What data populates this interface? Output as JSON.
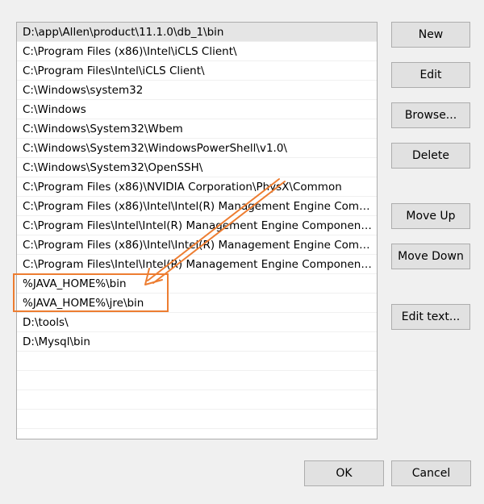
{
  "path_list": {
    "items": [
      "D:\\app\\Allen\\product\\11.1.0\\db_1\\bin",
      "C:\\Program Files (x86)\\Intel\\iCLS Client\\",
      "C:\\Program Files\\Intel\\iCLS Client\\",
      "C:\\Windows\\system32",
      "C:\\Windows",
      "C:\\Windows\\System32\\Wbem",
      "C:\\Windows\\System32\\WindowsPowerShell\\v1.0\\",
      "C:\\Windows\\System32\\OpenSSH\\",
      "C:\\Program Files (x86)\\NVIDIA Corporation\\PhysX\\Common",
      "C:\\Program Files (x86)\\Intel\\Intel(R) Management Engine Comp...",
      "C:\\Program Files\\Intel\\Intel(R) Management Engine Components...",
      "C:\\Program Files (x86)\\Intel\\Intel(R) Management Engine Comp...",
      "C:\\Program Files\\Intel\\Intel(R) Management Engine Components...",
      "%JAVA_HOME%\\bin",
      "%JAVA_HOME%\\jre\\bin",
      "D:\\tools\\",
      "D:\\Mysql\\bin"
    ],
    "selected_index": 0
  },
  "buttons": {
    "new": "New",
    "edit": "Edit",
    "browse": "Browse...",
    "delete": "Delete",
    "move_up": "Move Up",
    "move_down": "Move Down",
    "edit_text": "Edit text...",
    "ok": "OK",
    "cancel": "Cancel"
  },
  "colors": {
    "annotation": "#ed7d31",
    "selected_row": "#e5e5e5",
    "button_face": "#e1e1e1"
  }
}
